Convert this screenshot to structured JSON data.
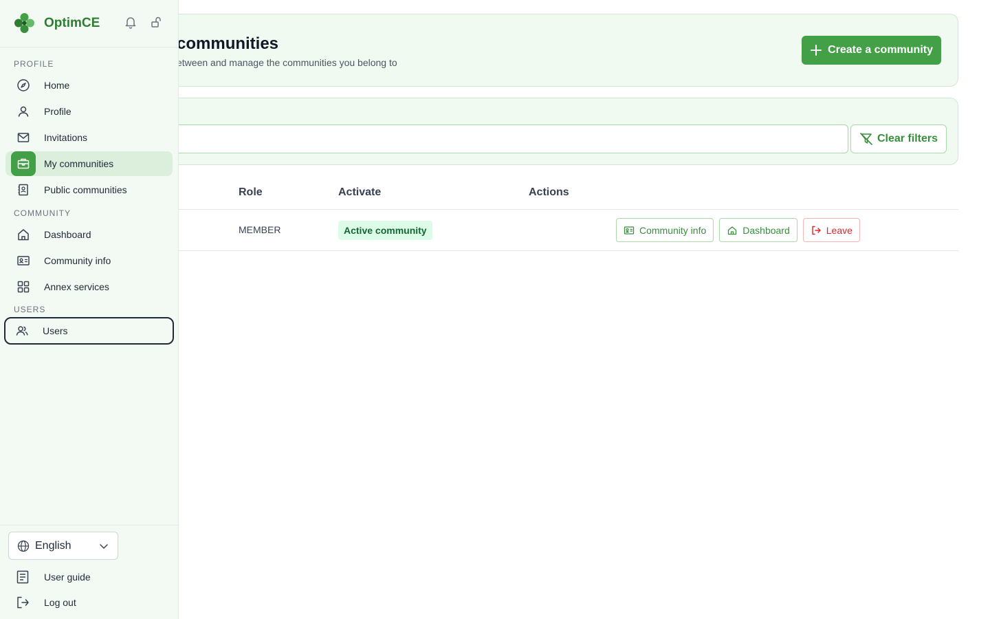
{
  "app": {
    "name": "OptimCE"
  },
  "sidebar": {
    "sections": {
      "profile": "PROFILE",
      "community": "COMMUNITY",
      "users": "USERS"
    },
    "items": {
      "home": "Home",
      "profile": "Profile",
      "invitations": "Invitations",
      "my_communities": "My communities",
      "public_communities": "Public communities",
      "dashboard": "Dashboard",
      "community_info": "Community info",
      "annex_services": "Annex services",
      "users": "Users"
    },
    "language": "English",
    "user_guide": "User guide",
    "log_out": "Log out"
  },
  "hero": {
    "title": "communities",
    "subtitle": "etween and manage the communities you belong to",
    "create_label": "Create a community"
  },
  "filter": {
    "search_value": "",
    "clear_label": "Clear filters"
  },
  "table": {
    "headers": {
      "role": "Role",
      "activate": "Activate",
      "actions": "Actions"
    },
    "rows": [
      {
        "role": "MEMBER",
        "status": "Active community",
        "actions": {
          "info": "Community info",
          "dashboard": "Dashboard",
          "leave": "Leave"
        }
      }
    ]
  },
  "colors": {
    "accent": "#43a047",
    "brand_text": "#2e7d32",
    "danger": "#dc2626",
    "panel_bg": "#f1faf1"
  }
}
